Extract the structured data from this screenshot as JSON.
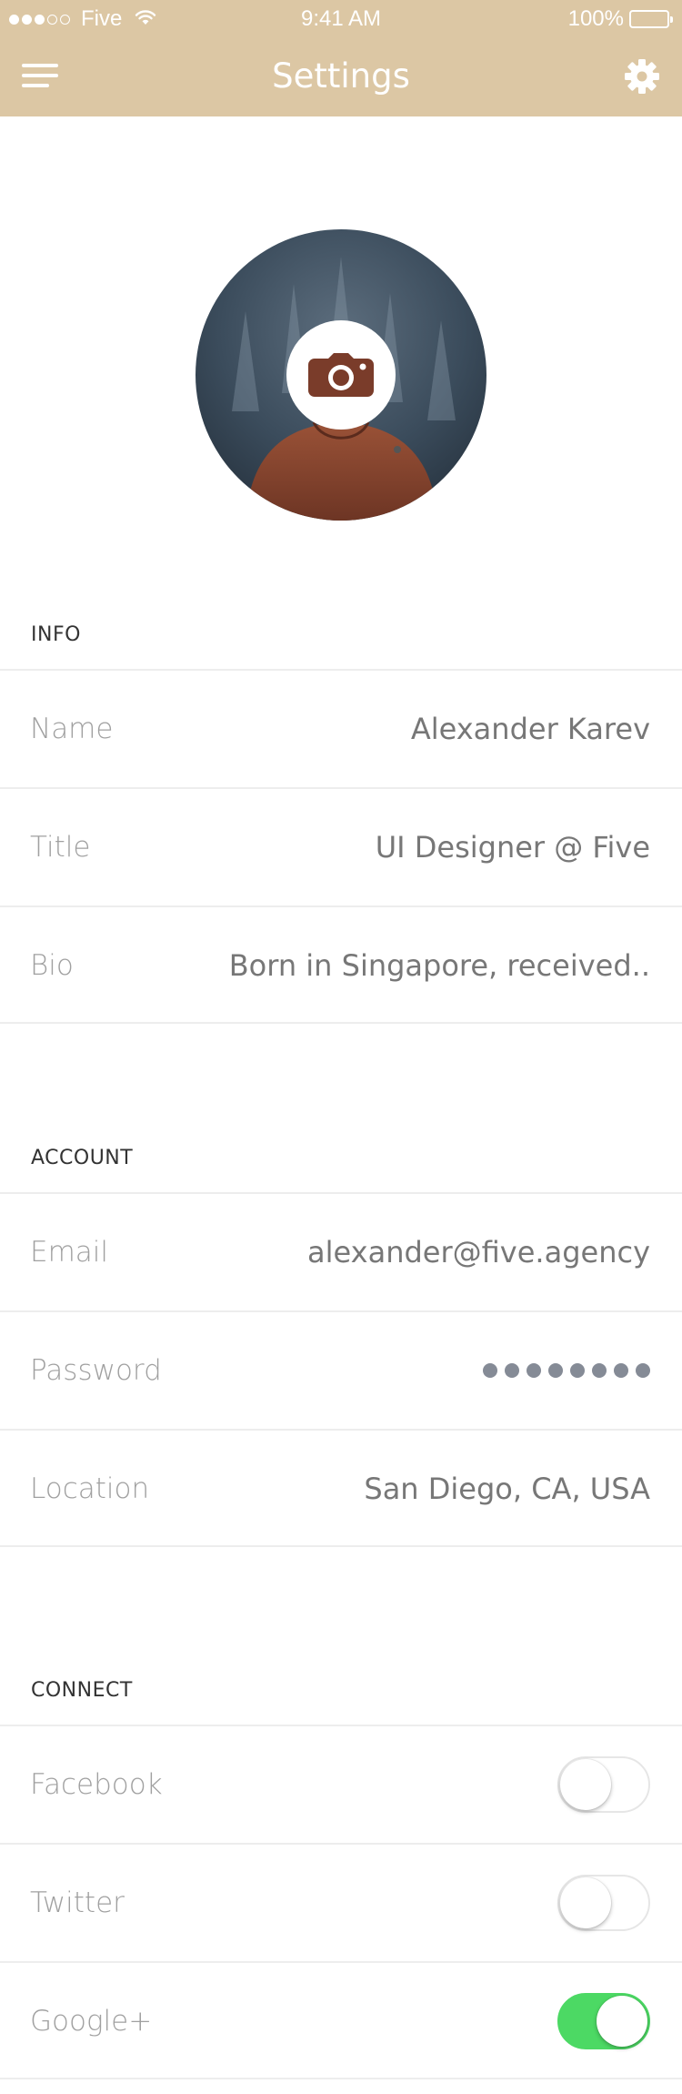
{
  "status_bar": {
    "carrier": "Five",
    "time": "9:41 AM",
    "battery": "100%",
    "signal_bars_filled": 3,
    "signal_bars_total": 5
  },
  "nav": {
    "title": "Settings",
    "menu_icon": "hamburger-menu-icon",
    "settings_icon": "gear-icon",
    "bar_color": "#dcc7a4"
  },
  "profile": {
    "photo_icon": "camera-icon"
  },
  "sections": {
    "info": {
      "header": "INFO",
      "name_label": "Name",
      "name_value": "Alexander Karev",
      "title_label": "Title",
      "title_value": "UI Designer @ Five",
      "bio_label": "Bio",
      "bio_value": "Born in Singapore, received.."
    },
    "account": {
      "header": "ACCOUNT",
      "email_label": "Email",
      "email_value": "alexander@five.agency",
      "password_label": "Password",
      "password_masked_length": 8,
      "location_label": "Location",
      "location_value": "San Diego, CA, USA"
    },
    "connect": {
      "header": "CONNECT",
      "facebook_label": "Facebook",
      "facebook_enabled": false,
      "twitter_label": "Twitter",
      "twitter_enabled": false,
      "google_label": "Google+",
      "google_enabled": true
    }
  },
  "colors": {
    "accent": "#dcc7a4",
    "toggle_on": "#4cd964",
    "label_gray": "#a0a0a0",
    "value_gray": "#777777"
  }
}
